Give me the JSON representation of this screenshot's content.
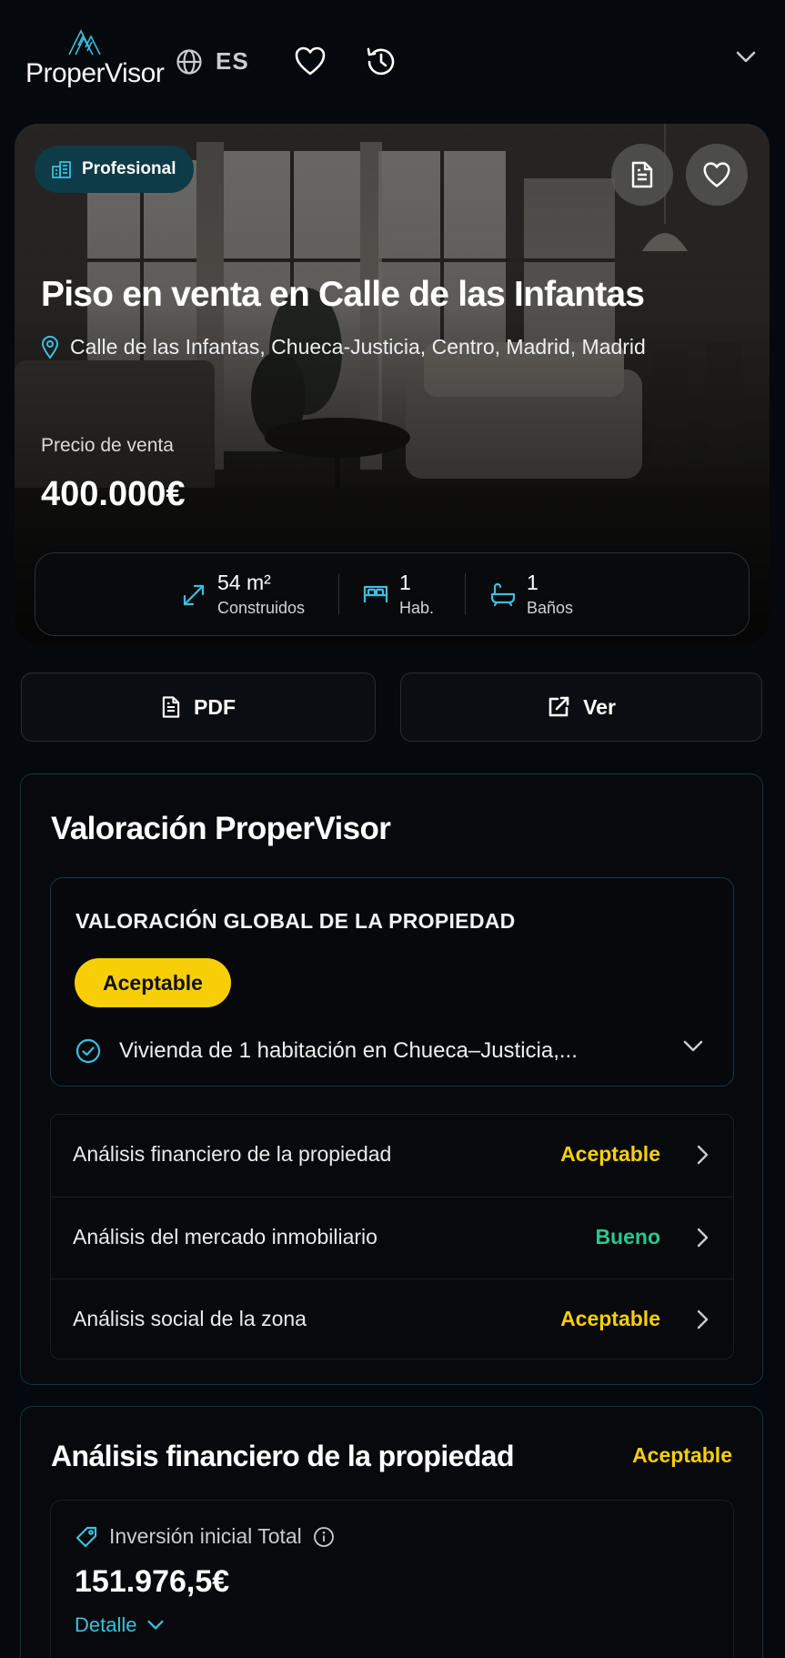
{
  "colors": {
    "accent": "#3cc0e0",
    "warning": "#f8cf06",
    "good": "#28c890",
    "background": "#05080c"
  },
  "header": {
    "logo_text": "ProperVisor",
    "language_code": "ES",
    "icons": [
      "globe-icon",
      "heart-icon",
      "history-icon",
      "chevron-down-icon"
    ]
  },
  "listing": {
    "badge": "Profesional",
    "title": "Piso en venta en Calle de las Infantas",
    "address": "Calle de las Infantas, Chueca-Justicia, Centro, Madrid, Madrid",
    "price_label": "Precio de venta",
    "price": "400.000€",
    "stats": [
      {
        "value": "54 m²",
        "label": "Construidos",
        "icon": "expand-icon"
      },
      {
        "value": "1",
        "label": "Hab.",
        "icon": "bed-icon"
      },
      {
        "value": "1",
        "label": "Baños",
        "icon": "bath-icon"
      }
    ]
  },
  "actions": {
    "pdf_label": "PDF",
    "view_label": "Ver"
  },
  "valuation": {
    "title": "Valoración ProperVisor",
    "global_title": "VALORACIÓN GLOBAL DE LA PROPIEDAD",
    "global_rating": "Aceptable",
    "summary": "Vivienda de 1 habitación en Chueca–Justicia,...",
    "analyses": [
      {
        "name": "Análisis financiero de la propiedad",
        "status": "Aceptable",
        "color": "#f8cf06"
      },
      {
        "name": "Análisis del mercado inmobiliario",
        "status": "Bueno",
        "color": "#28c890"
      },
      {
        "name": "Análisis social de la zona",
        "status": "Aceptable",
        "color": "#f8cf06"
      }
    ]
  },
  "financial": {
    "title": "Análisis financiero de la propiedad",
    "status": "Aceptable",
    "investment_label": "Inversión inicial Total",
    "investment_value": "151.976,5€",
    "detail_label": "Detalle"
  }
}
